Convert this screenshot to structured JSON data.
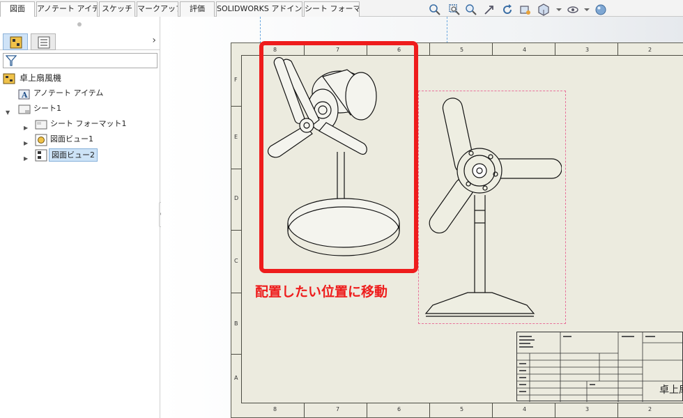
{
  "tabs": [
    "図面",
    "アノテート アイテム",
    "スケッチ",
    "マークアップ",
    "評価",
    "SOLIDWORKS アドイン",
    "シート フォーマット"
  ],
  "active_tab": "図面",
  "heads_up_toolbar": [
    "zoom-to-fit-icon",
    "zoom-to-area-icon",
    "zoom-in-out-icon",
    "pan-icon",
    "rotate-icon",
    "previous-view-icon",
    "view-orientation-icon",
    "display-style-icon",
    "hide-show-items-icon",
    "appearance-icon"
  ],
  "feature_tree": {
    "root": "卓上扇風機",
    "items": [
      {
        "label": "アノテート アイテム",
        "icon": "annotation-a-icon"
      },
      {
        "label": "シート1",
        "icon": "sheet-icon",
        "expanded": true
      },
      {
        "label": "シート フォーマット1",
        "icon": "sheet-format-icon"
      },
      {
        "label": "図面ビュー1",
        "icon": "drawing-view-icon"
      },
      {
        "label": "図面ビュー2",
        "icon": "drawing-view-icon",
        "selected": true
      }
    ]
  },
  "sheet": {
    "top_zones": [
      "8",
      "7",
      "6",
      "5",
      "4",
      "3",
      "2"
    ],
    "side_zones": [
      "F",
      "E",
      "D",
      "C",
      "B",
      "A"
    ],
    "title_text": "卓上扇"
  },
  "annotation": "配置したい位置に移動",
  "colors": {
    "highlight": "#ee1c1c",
    "sheet": "#ecebdf",
    "selection": "#cde3f7",
    "guide": "#6da9e0",
    "view_boundary": "#e8719a"
  }
}
